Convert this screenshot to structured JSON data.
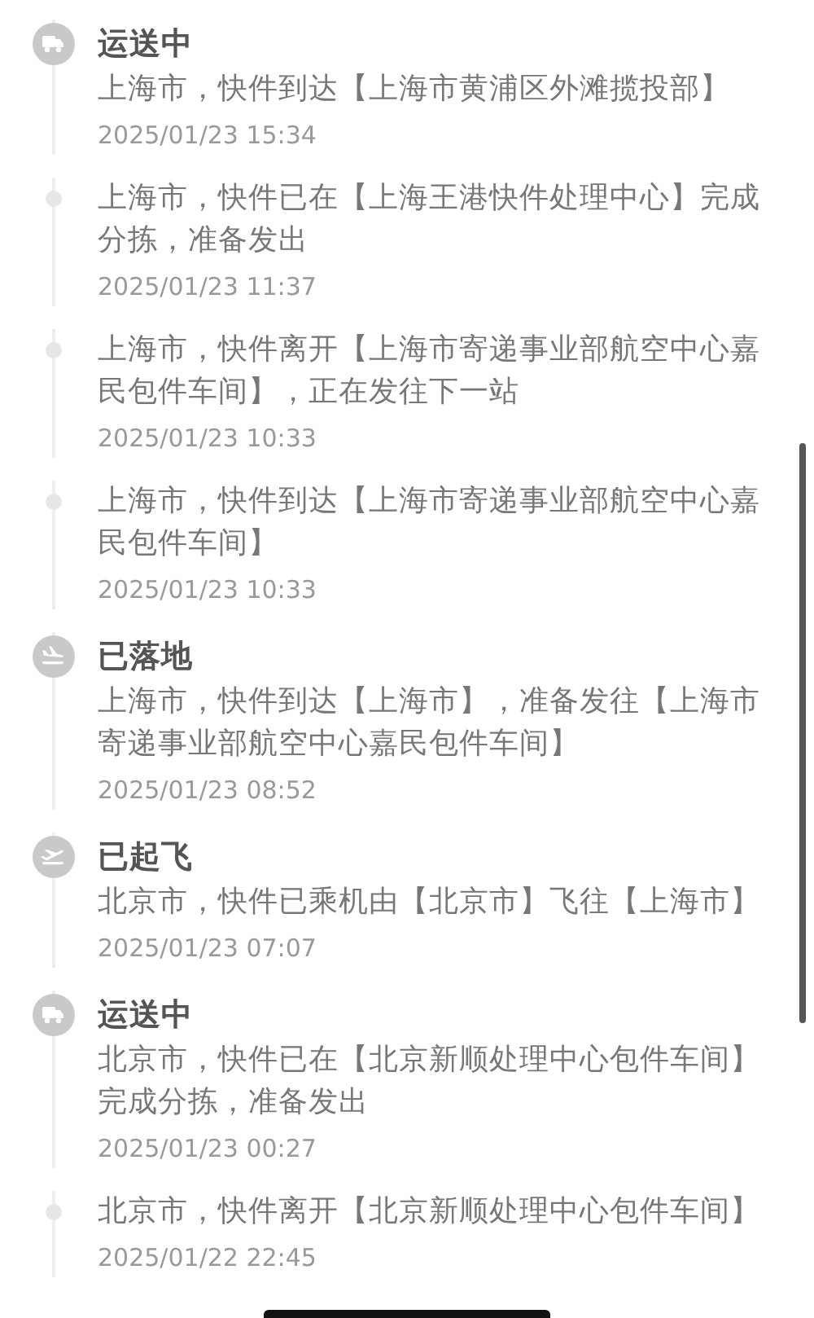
{
  "events": [
    {
      "kind": "in_transit",
      "title": "运送中",
      "detail": "上海市，快件到达【上海市黄浦区外滩揽投部】",
      "time": "2025/01/23 15:34"
    },
    {
      "kind": "update",
      "detail": "上海市，快件已在【上海王港快件处理中心】完成分拣，准备发出",
      "time": "2025/01/23 11:37"
    },
    {
      "kind": "update",
      "detail": "上海市，快件离开【上海市寄递事业部航空中心嘉民包件车间】，正在发往下一站",
      "time": "2025/01/23 10:33"
    },
    {
      "kind": "update",
      "detail": "上海市，快件到达【上海市寄递事业部航空中心嘉民包件车间】",
      "time": "2025/01/23 10:33"
    },
    {
      "kind": "landed",
      "title": "已落地",
      "detail": "上海市，快件到达【上海市】，准备发往【上海市寄递事业部航空中心嘉民包件车间】",
      "time": "2025/01/23 08:52"
    },
    {
      "kind": "took_off",
      "title": "已起飞",
      "detail": "北京市，快件已乘机由【北京市】飞往【上海市】",
      "time": "2025/01/23 07:07"
    },
    {
      "kind": "in_transit",
      "title": "运送中",
      "detail": "北京市，快件已在【北京新顺处理中心包件车间】完成分拣，准备发出",
      "time": "2025/01/23 00:27"
    },
    {
      "kind": "update",
      "detail": "北京市，快件离开【北京新顺处理中心包件车间】",
      "time": "2025/01/22 22:45"
    }
  ]
}
